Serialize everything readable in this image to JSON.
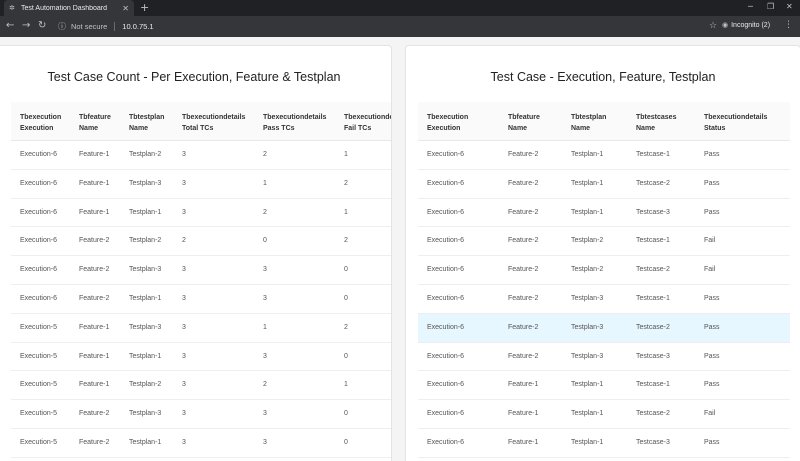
{
  "browser": {
    "tab_title": "Test Automation Dashboard",
    "security_label": "Not secure",
    "url": "10.0.75.1",
    "mode_label": "Incognito (2)"
  },
  "left_card": {
    "title": "Test Case Count - Per Execution, Feature & Testplan",
    "headers": [
      "Tbexecution\nExecution",
      "Tbfeature\nName",
      "Tbtestplan\nName",
      "Tbexecutiondetails\nTotal TCs",
      "Tbexecutiondetails\nPass TCs",
      "Tbexecutiondetails\nFail TCs"
    ],
    "rows": [
      [
        "Execution-6",
        "Feature-1",
        "Testplan-2",
        "3",
        "2",
        "1"
      ],
      [
        "Execution-6",
        "Feature-1",
        "Testplan-3",
        "3",
        "1",
        "2"
      ],
      [
        "Execution-6",
        "Feature-1",
        "Testplan-1",
        "3",
        "2",
        "1"
      ],
      [
        "Execution-6",
        "Feature-2",
        "Testplan-2",
        "2",
        "0",
        "2"
      ],
      [
        "Execution-6",
        "Feature-2",
        "Testplan-3",
        "3",
        "3",
        "0"
      ],
      [
        "Execution-6",
        "Feature-2",
        "Testplan-1",
        "3",
        "3",
        "0"
      ],
      [
        "Execution-5",
        "Feature-1",
        "Testplan-3",
        "3",
        "1",
        "2"
      ],
      [
        "Execution-5",
        "Feature-1",
        "Testplan-1",
        "3",
        "3",
        "0"
      ],
      [
        "Execution-5",
        "Feature-1",
        "Testplan-2",
        "3",
        "2",
        "1"
      ],
      [
        "Execution-5",
        "Feature-2",
        "Testplan-3",
        "3",
        "3",
        "0"
      ],
      [
        "Execution-5",
        "Feature-2",
        "Testplan-1",
        "3",
        "3",
        "0"
      ]
    ]
  },
  "right_card": {
    "title": "Test Case - Execution, Feature, Testplan",
    "headers": [
      "Tbexecution\nExecution",
      "Tbfeature\nName",
      "Tbtestplan\nName",
      "Tbtestcases\nName",
      "Tbexecutiondetails\nStatus"
    ],
    "highlight_color": "#e6f7ff",
    "rows": [
      [
        "Execution-6",
        "Feature-2",
        "Testplan-1",
        "Testcase-1",
        "Pass"
      ],
      [
        "Execution-6",
        "Feature-2",
        "Testplan-1",
        "Testcase-2",
        "Pass"
      ],
      [
        "Execution-6",
        "Feature-2",
        "Testplan-1",
        "Testcase-3",
        "Pass"
      ],
      [
        "Execution-6",
        "Feature-2",
        "Testplan-2",
        "Testcase-1",
        "Fail"
      ],
      [
        "Execution-6",
        "Feature-2",
        "Testplan-2",
        "Testcase-2",
        "Fail"
      ],
      [
        "Execution-6",
        "Feature-2",
        "Testplan-3",
        "Testcase-1",
        "Pass"
      ],
      [
        "Execution-6",
        "Feature-2",
        "Testplan-3",
        "Testcase-2",
        "Pass"
      ],
      [
        "Execution-6",
        "Feature-2",
        "Testplan-3",
        "Testcase-3",
        "Pass"
      ],
      [
        "Execution-6",
        "Feature-1",
        "Testplan-1",
        "Testcase-1",
        "Pass"
      ],
      [
        "Execution-6",
        "Feature-1",
        "Testplan-1",
        "Testcase-2",
        "Fail"
      ],
      [
        "Execution-6",
        "Feature-1",
        "Testplan-1",
        "Testcase-3",
        "Pass"
      ]
    ]
  }
}
